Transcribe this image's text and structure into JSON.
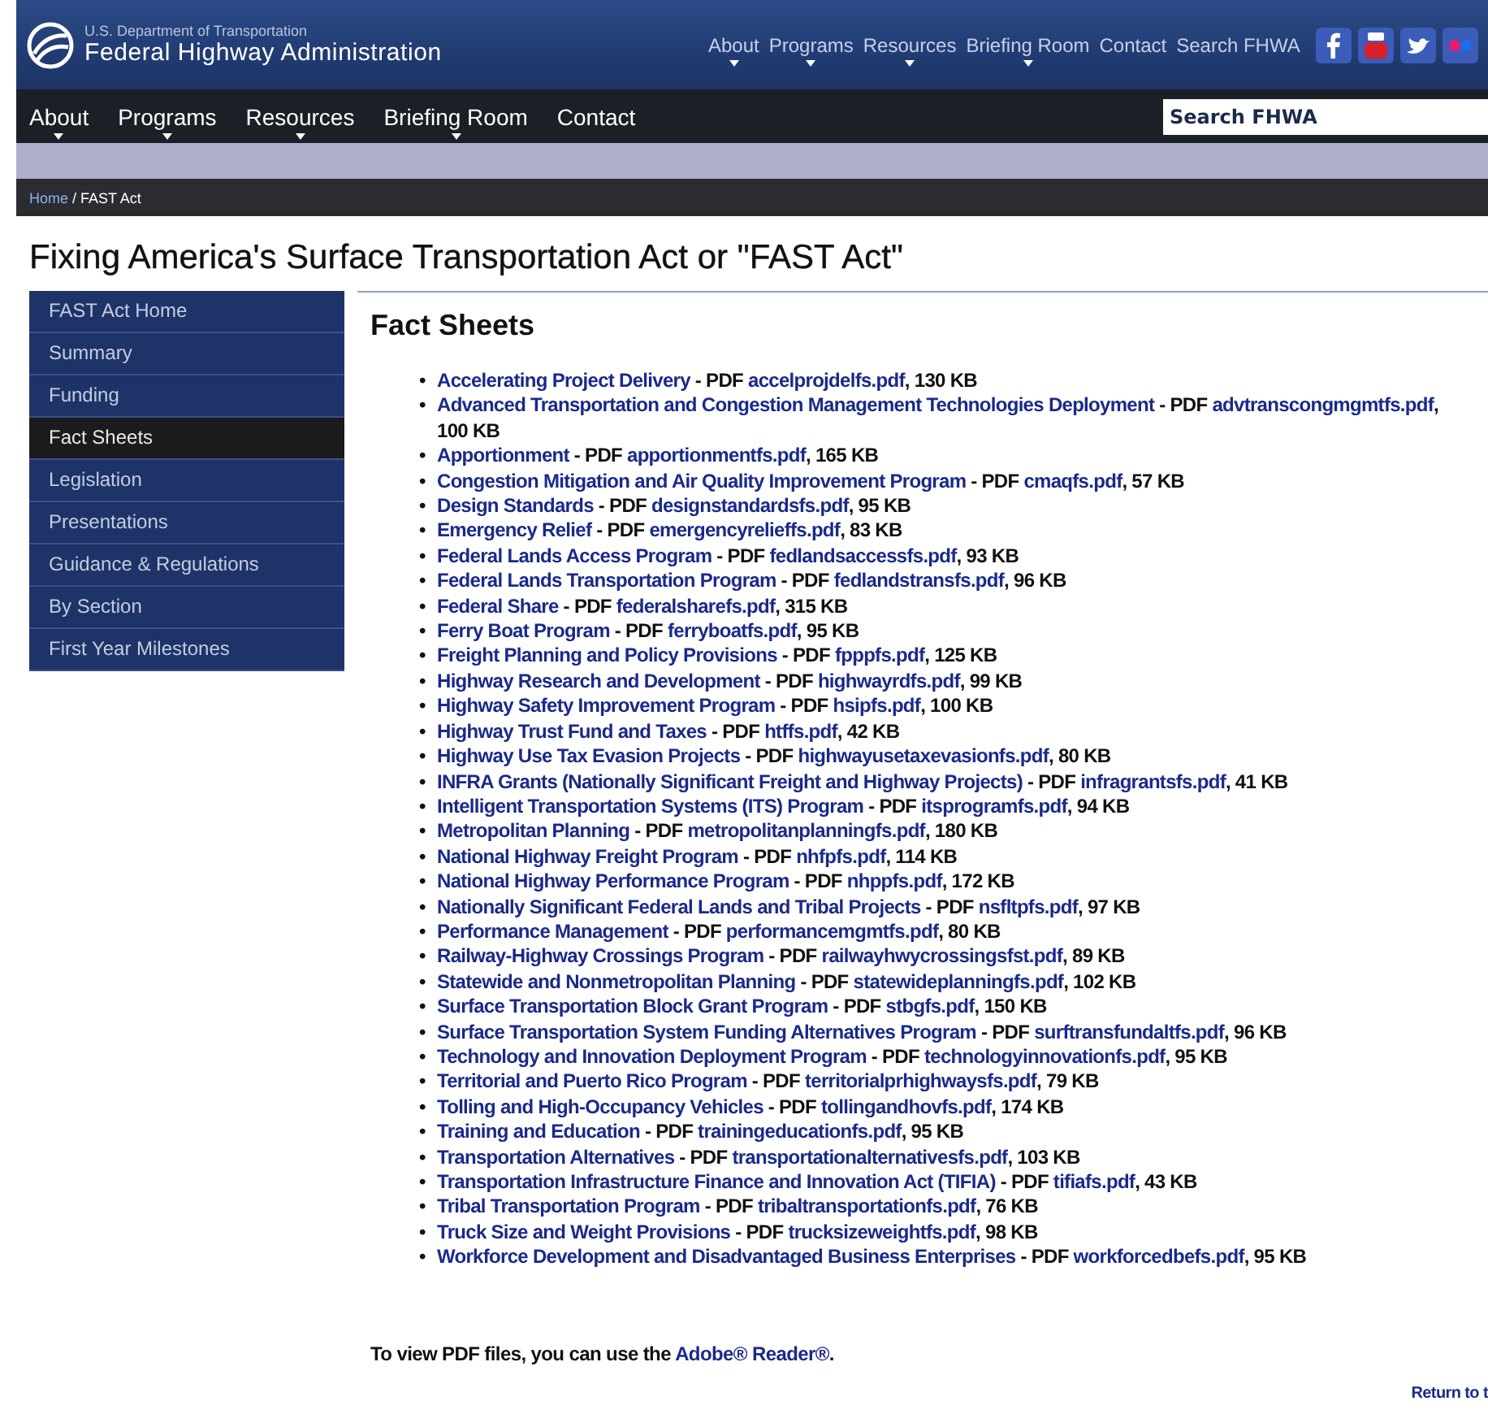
{
  "header": {
    "agency_line": "U.S. Department of Transportation",
    "agency": "Federal Highway Administration",
    "top_links": [
      {
        "label": "About",
        "dropdown": true
      },
      {
        "label": "Programs",
        "dropdown": true
      },
      {
        "label": "Resources",
        "dropdown": true
      },
      {
        "label": "Briefing Room",
        "dropdown": true
      },
      {
        "label": "Contact",
        "dropdown": false
      },
      {
        "label": "Search FHWA",
        "dropdown": false
      }
    ]
  },
  "nav": {
    "items": [
      {
        "label": "About",
        "dropdown": true
      },
      {
        "label": "Programs",
        "dropdown": true
      },
      {
        "label": "Resources",
        "dropdown": true
      },
      {
        "label": "Briefing Room",
        "dropdown": true
      },
      {
        "label": "Contact",
        "dropdown": false
      }
    ],
    "search": {
      "placeholder": "Search FHWA"
    }
  },
  "breadcrumb": {
    "home": "Home",
    "separator": " / ",
    "current": "FAST Act"
  },
  "page_title": "Fixing America's Surface Transportation Act or \"FAST Act\"",
  "sidebar": {
    "items": [
      {
        "label": "FAST Act Home",
        "selected": false
      },
      {
        "label": "Summary",
        "selected": false
      },
      {
        "label": "Funding",
        "selected": false
      },
      {
        "label": "Fact Sheets",
        "selected": true
      },
      {
        "label": "Legislation",
        "selected": false
      },
      {
        "label": "Presentations",
        "selected": false
      },
      {
        "label": "Guidance & Regulations",
        "selected": false
      },
      {
        "label": "By Section",
        "selected": false
      },
      {
        "label": "First Year Milestones",
        "selected": false
      }
    ]
  },
  "content": {
    "heading": "Fact Sheets",
    "fact_sheets": [
      {
        "bullet": "•",
        "title": "Accelerating Project Delivery",
        "format": " - PDF ",
        "file": "accelprojdelfs.pdf",
        "size": ", 130 KB"
      },
      {
        "bullet": "•",
        "title": "Advanced Transportation and Congestion Management Technologies Deployment",
        "format": " - PDF ",
        "file": "advtranscongmgmtfs.pdf",
        "size": ", 100 KB"
      },
      {
        "bullet": "•",
        "title": "Apportionment",
        "format": " - PDF ",
        "file": "apportionmentfs.pdf",
        "size": ", 165 KB"
      },
      {
        "bullet": "•",
        "title": "Congestion Mitigation and Air Quality Improvement Program",
        "format": " - PDF ",
        "file": "cmaqfs.pdf",
        "size": ", 57 KB"
      },
      {
        "bullet": "•",
        "title": "Design Standards",
        "format": " - PDF ",
        "file": "designstandardsfs.pdf",
        "size": ", 95 KB"
      },
      {
        "bullet": "•",
        "title": "Emergency Relief",
        "format": " - PDF ",
        "file": "emergencyrelieffs.pdf",
        "size": ", 83 KB"
      },
      {
        "bullet": "•",
        "title": "Federal Lands Access Program",
        "format": " - PDF ",
        "file": "fedlandsaccessfs.pdf",
        "size": ", 93 KB"
      },
      {
        "bullet": "•",
        "title": "Federal Lands Transportation Program",
        "format": " - PDF ",
        "file": "fedlandstransfs.pdf",
        "size": ", 96 KB"
      },
      {
        "bullet": "•",
        "title": "Federal Share",
        "format": " - PDF ",
        "file": "federalsharefs.pdf",
        "size": ", 315 KB"
      },
      {
        "bullet": "•",
        "title": "Ferry Boat Program",
        "format": " - PDF ",
        "file": "ferryboatfs.pdf",
        "size": ", 95 KB"
      },
      {
        "bullet": "•",
        "title": "Freight Planning and Policy Provisions",
        "format": " - PDF ",
        "file": "fpppfs.pdf",
        "size": ", 125 KB"
      },
      {
        "bullet": "•",
        "title": "Highway Research and Development",
        "format": " - PDF ",
        "file": "highwayrdfs.pdf",
        "size": ", 99 KB"
      },
      {
        "bullet": "•",
        "title": "Highway Safety Improvement Program",
        "format": " - PDF ",
        "file": "hsipfs.pdf",
        "size": ", 100 KB"
      },
      {
        "bullet": "•",
        "title": "Highway Trust Fund and Taxes",
        "format": " - PDF ",
        "file": "htffs.pdf",
        "size": ", 42 KB"
      },
      {
        "bullet": "•",
        "title": "Highway Use Tax Evasion Projects",
        "format": " - PDF ",
        "file": "highwayusetaxevasionfs.pdf",
        "size": ", 80 KB"
      },
      {
        "bullet": "•",
        "title": "INFRA Grants (Nationally Significant Freight and Highway Projects)",
        "format": " - PDF ",
        "file": "infragrantsfs.pdf",
        "size": ", 41 KB"
      },
      {
        "bullet": "•",
        "title": "Intelligent Transportation Systems (ITS) Program",
        "format": " - PDF ",
        "file": "itsprogramfs.pdf",
        "size": ", 94 KB"
      },
      {
        "bullet": "•",
        "title": "Metropolitan Planning",
        "format": " - PDF ",
        "file": "metropolitanplanningfs.pdf",
        "size": ", 180 KB"
      },
      {
        "bullet": "•",
        "title": "National Highway Freight Program",
        "format": " - PDF ",
        "file": "nhfpfs.pdf",
        "size": ", 114 KB"
      },
      {
        "bullet": "•",
        "title": "National Highway Performance Program",
        "format": " - PDF ",
        "file": "nhppfs.pdf",
        "size": ", 172 KB"
      },
      {
        "bullet": "•",
        "title": "Nationally Significant Federal Lands and Tribal Projects",
        "format": " - PDF ",
        "file": "nsfltpfs.pdf",
        "size": ", 97 KB"
      },
      {
        "bullet": "•",
        "title": "Performance Management",
        "format": " - PDF ",
        "file": "performancemgmtfs.pdf",
        "size": ", 80 KB"
      },
      {
        "bullet": "•",
        "title": "Railway-Highway Crossings Program",
        "format": " - PDF ",
        "file": "railwayhwycrossingsfst.pdf",
        "size": ", 89 KB"
      },
      {
        "bullet": "•",
        "title": "Statewide and Nonmetropolitan Planning",
        "format": " - PDF ",
        "file": "statewideplanningfs.pdf",
        "size": ", 102 KB"
      },
      {
        "bullet": "•",
        "title": "Surface Transportation Block Grant Program",
        "format": " - PDF ",
        "file": "stbgfs.pdf",
        "size": ", 150 KB"
      },
      {
        "bullet": "•",
        "title": "Surface Transportation System Funding Alternatives Program",
        "format": " - PDF ",
        "file": "surftransfundaltfs.pdf",
        "size": ", 96 KB"
      },
      {
        "bullet": "•",
        "title": "Technology and Innovation Deployment Program",
        "format": " - PDF ",
        "file": "technologyinnovationfs.pdf",
        "size": ", 95 KB"
      },
      {
        "bullet": "•",
        "title": "Territorial and Puerto Rico Program",
        "format": " - PDF ",
        "file": "territorialprhighwaysfs.pdf",
        "size": ", 79 KB"
      },
      {
        "bullet": "•",
        "title": "Tolling and High-Occupancy Vehicles",
        "format": " - PDF ",
        "file": "tollingandhovfs.pdf",
        "size": ", 174 KB"
      },
      {
        "bullet": "•",
        "title": "Training and Education",
        "format": " - PDF ",
        "file": "trainingeducationfs.pdf",
        "size": ", 95 KB"
      },
      {
        "bullet": "•",
        "title": "Transportation Alternatives",
        "format": " - PDF ",
        "file": "transportationalternativesfs.pdf",
        "size": ", 103 KB"
      },
      {
        "bullet": "•",
        "title": "Transportation Infrastructure Finance and Innovation Act (TIFIA)",
        "format": " - PDF ",
        "file": "tifiafs.pdf",
        "size": ", 43 KB"
      },
      {
        "bullet": "•",
        "title": "Tribal Transportation Program",
        "format": " - PDF ",
        "file": "tribaltransportationfs.pdf",
        "size": ", 76 KB"
      },
      {
        "bullet": "•",
        "title": "Truck Size and Weight Provisions",
        "format": " - PDF ",
        "file": "trucksizeweightfs.pdf",
        "size": ", 98 KB"
      },
      {
        "bullet": "•",
        "title": "Workforce Development and Disadvantaged Business Enterprises",
        "format": " - PDF ",
        "file": "workforcedbefs.pdf",
        "size": ", 95 KB"
      }
    ],
    "pdf_note": {
      "text": "To view PDF files, you can use the ",
      "link": "Adobe® Reader®",
      "end": "."
    },
    "return_link": "Return to t"
  }
}
